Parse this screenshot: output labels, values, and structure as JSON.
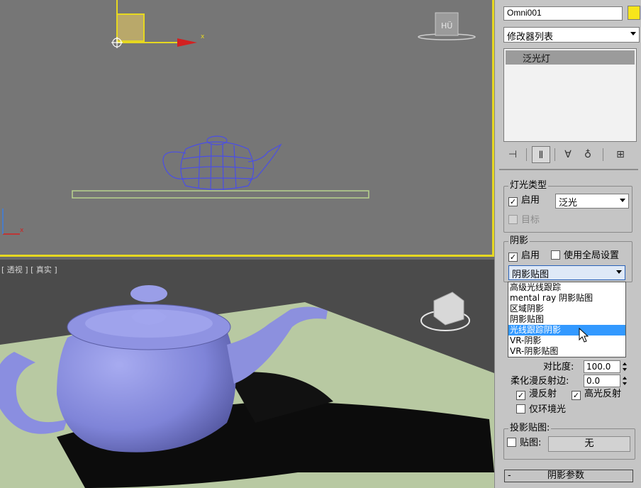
{
  "viewports": {
    "perspective_label": "[ 透视 ] [ 真实 ]",
    "viewcube_top_text": "前",
    "active_border_color": "#e6d820"
  },
  "panel": {
    "object_name": "Omni001",
    "object_color": "#f7e51b",
    "modifier_list": "修改器列表",
    "stack_item": "泛光灯",
    "light_type": {
      "title": "灯光类型",
      "enable_label": "启用",
      "enable_checked": true,
      "type_value": "泛光",
      "target_label": "目标"
    },
    "shadows": {
      "title": "阴影",
      "enable_label": "启用",
      "global_label": "使用全局设置",
      "selected": "阴影贴图",
      "options": [
        "高级光线跟踪",
        "mental ray 阴影贴图",
        "区域阴影",
        "阴影贴图",
        "光线跟踪阴影",
        "VR-阴影",
        "VR-阴影贴图"
      ],
      "highlighted_option": "光线跟踪阴影"
    },
    "contrast_label": "对比度:",
    "contrast_value": "100.0",
    "soften_label": "柔化漫反射边:",
    "soften_value": "0.0",
    "diffuse_label": "漫反射",
    "specular_label": "高光反射",
    "ambient_label": "仅环境光",
    "projector": {
      "title": "投影贴图:",
      "map_label": "贴图:",
      "map_button": "无"
    },
    "rollout_shadow_params": "阴影参数",
    "rollout_sign": "-"
  }
}
